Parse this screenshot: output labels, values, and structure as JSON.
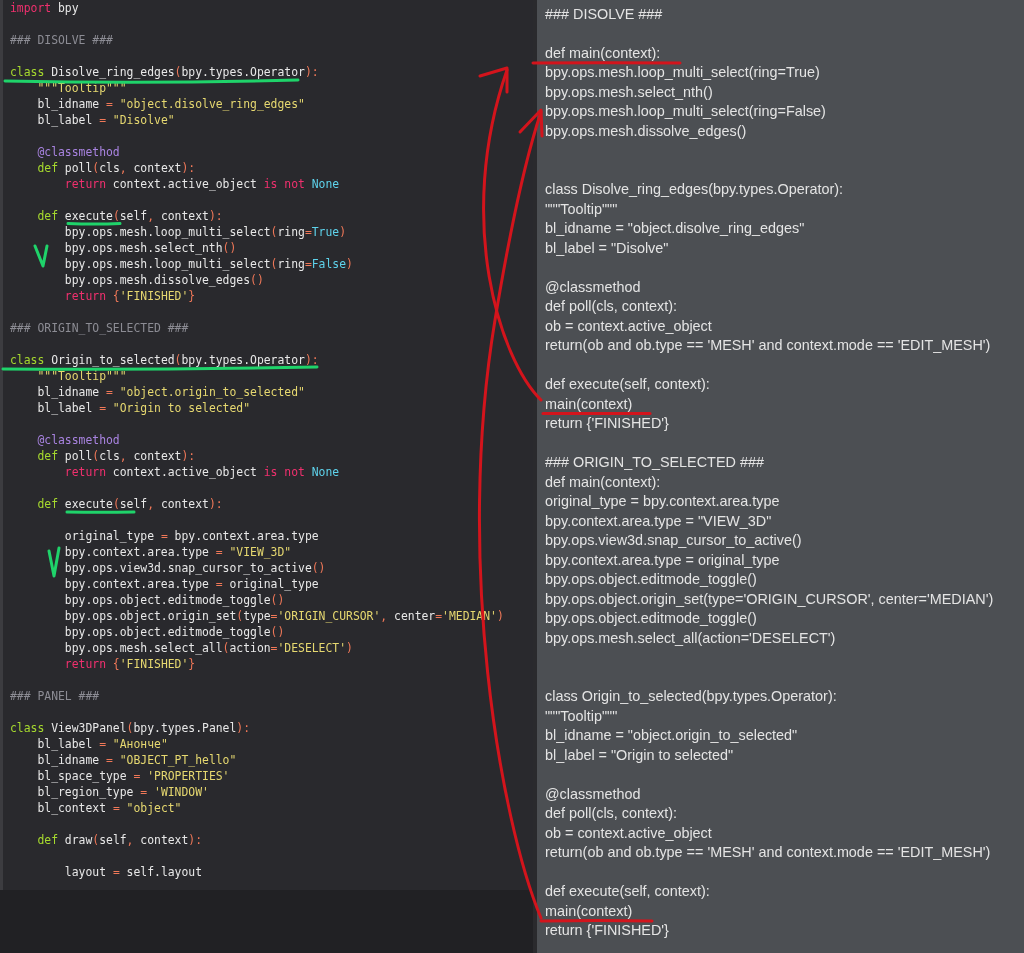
{
  "editor": {
    "lines": [
      {
        "kind": "code",
        "tokens": [
          {
            "text": "import",
            "kind": "kw"
          },
          {
            "text": " bpy",
            "kind": "id"
          }
        ]
      },
      {
        "kind": "blank"
      },
      {
        "kind": "code",
        "tokens": [
          {
            "text": "### DISOLVE ###",
            "kind": "cmt"
          }
        ]
      },
      {
        "kind": "blank"
      },
      {
        "kind": "code",
        "tokens": [
          {
            "text": "class",
            "kind": "def"
          },
          {
            "text": " Disolve_ring_edges",
            "kind": "id"
          },
          {
            "text": "(",
            "kind": "op"
          },
          {
            "text": "bpy.types.Operator",
            "kind": "id"
          },
          {
            "text": "):",
            "kind": "op"
          }
        ]
      },
      {
        "kind": "code",
        "tokens": [
          {
            "text": "    \"\"\"Tooltip\"\"\"",
            "kind": "str"
          }
        ]
      },
      {
        "kind": "code",
        "tokens": [
          {
            "text": "    bl_idname ",
            "kind": "id"
          },
          {
            "text": "=",
            "kind": "op"
          },
          {
            "text": " \"object.disolve_ring_edges\"",
            "kind": "str"
          }
        ]
      },
      {
        "kind": "code",
        "tokens": [
          {
            "text": "    bl_label ",
            "kind": "id"
          },
          {
            "text": "=",
            "kind": "op"
          },
          {
            "text": " \"Disolve\"",
            "kind": "str"
          }
        ]
      },
      {
        "kind": "blank"
      },
      {
        "kind": "code",
        "tokens": [
          {
            "text": "    @classmethod",
            "kind": "deco"
          }
        ]
      },
      {
        "kind": "code",
        "tokens": [
          {
            "text": "    def",
            "kind": "def"
          },
          {
            "text": " poll",
            "kind": "id"
          },
          {
            "text": "(",
            "kind": "op"
          },
          {
            "text": "cls",
            "kind": "id"
          },
          {
            "text": ", ",
            "kind": "op"
          },
          {
            "text": "context",
            "kind": "id"
          },
          {
            "text": "):",
            "kind": "op"
          }
        ]
      },
      {
        "kind": "code",
        "tokens": [
          {
            "text": "        return",
            "kind": "kw"
          },
          {
            "text": " context.active_object ",
            "kind": "id"
          },
          {
            "text": "is not",
            "kind": "kw"
          },
          {
            "text": " None",
            "kind": "const"
          }
        ]
      },
      {
        "kind": "blank"
      },
      {
        "kind": "code",
        "tokens": [
          {
            "text": "    def",
            "kind": "def"
          },
          {
            "text": " execute",
            "kind": "id"
          },
          {
            "text": "(",
            "kind": "op"
          },
          {
            "text": "self",
            "kind": "id"
          },
          {
            "text": ", ",
            "kind": "op"
          },
          {
            "text": "context",
            "kind": "id"
          },
          {
            "text": "):",
            "kind": "op"
          }
        ]
      },
      {
        "kind": "code",
        "tokens": [
          {
            "text": "        bpy.ops.mesh.loop_multi_select",
            "kind": "id"
          },
          {
            "text": "(",
            "kind": "op"
          },
          {
            "text": "ring",
            "kind": "id"
          },
          {
            "text": "=",
            "kind": "op"
          },
          {
            "text": "True",
            "kind": "const"
          },
          {
            "text": ")",
            "kind": "op"
          }
        ]
      },
      {
        "kind": "code",
        "tokens": [
          {
            "text": "        bpy.ops.mesh.select_nth",
            "kind": "id"
          },
          {
            "text": "()",
            "kind": "op"
          }
        ]
      },
      {
        "kind": "code",
        "tokens": [
          {
            "text": "        bpy.ops.mesh.loop_multi_select",
            "kind": "id"
          },
          {
            "text": "(",
            "kind": "op"
          },
          {
            "text": "ring",
            "kind": "id"
          },
          {
            "text": "=",
            "kind": "op"
          },
          {
            "text": "False",
            "kind": "const"
          },
          {
            "text": ")",
            "kind": "op"
          }
        ]
      },
      {
        "kind": "code",
        "tokens": [
          {
            "text": "        bpy.ops.mesh.dissolve_edges",
            "kind": "id"
          },
          {
            "text": "()",
            "kind": "op"
          }
        ]
      },
      {
        "kind": "code",
        "tokens": [
          {
            "text": "        return",
            "kind": "kw"
          },
          {
            "text": " {",
            "kind": "op"
          },
          {
            "text": "'FINISHED'",
            "kind": "str"
          },
          {
            "text": "}",
            "kind": "op"
          }
        ]
      },
      {
        "kind": "blank"
      },
      {
        "kind": "code",
        "tokens": [
          {
            "text": "### ORIGIN_TO_SELECTED ###",
            "kind": "cmt"
          }
        ]
      },
      {
        "kind": "blank"
      },
      {
        "kind": "code",
        "tokens": [
          {
            "text": "class",
            "kind": "def"
          },
          {
            "text": " Origin_to_selected",
            "kind": "id"
          },
          {
            "text": "(",
            "kind": "op"
          },
          {
            "text": "bpy.types.Operator",
            "kind": "id"
          },
          {
            "text": "):",
            "kind": "op"
          }
        ]
      },
      {
        "kind": "code",
        "tokens": [
          {
            "text": "    \"\"\"Tooltip\"\"\"",
            "kind": "str"
          }
        ]
      },
      {
        "kind": "code",
        "tokens": [
          {
            "text": "    bl_idname ",
            "kind": "id"
          },
          {
            "text": "=",
            "kind": "op"
          },
          {
            "text": " \"object.origin_to_selected\"",
            "kind": "str"
          }
        ]
      },
      {
        "kind": "code",
        "tokens": [
          {
            "text": "    bl_label ",
            "kind": "id"
          },
          {
            "text": "=",
            "kind": "op"
          },
          {
            "text": " \"Origin to selected\"",
            "kind": "str"
          }
        ]
      },
      {
        "kind": "blank"
      },
      {
        "kind": "code",
        "tokens": [
          {
            "text": "    @classmethod",
            "kind": "deco"
          }
        ]
      },
      {
        "kind": "code",
        "tokens": [
          {
            "text": "    def",
            "kind": "def"
          },
          {
            "text": " poll",
            "kind": "id"
          },
          {
            "text": "(",
            "kind": "op"
          },
          {
            "text": "cls",
            "kind": "id"
          },
          {
            "text": ", ",
            "kind": "op"
          },
          {
            "text": "context",
            "kind": "id"
          },
          {
            "text": "):",
            "kind": "op"
          }
        ]
      },
      {
        "kind": "code",
        "tokens": [
          {
            "text": "        return",
            "kind": "kw"
          },
          {
            "text": " context.active_object ",
            "kind": "id"
          },
          {
            "text": "is not",
            "kind": "kw"
          },
          {
            "text": " None",
            "kind": "const"
          }
        ]
      },
      {
        "kind": "blank"
      },
      {
        "kind": "code",
        "tokens": [
          {
            "text": "    def",
            "kind": "def"
          },
          {
            "text": " execute",
            "kind": "id"
          },
          {
            "text": "(",
            "kind": "op"
          },
          {
            "text": "self",
            "kind": "id"
          },
          {
            "text": ", ",
            "kind": "op"
          },
          {
            "text": "context",
            "kind": "id"
          },
          {
            "text": "):",
            "kind": "op"
          }
        ]
      },
      {
        "kind": "blank"
      },
      {
        "kind": "code",
        "tokens": [
          {
            "text": "        original_type ",
            "kind": "id"
          },
          {
            "text": "=",
            "kind": "op"
          },
          {
            "text": " bpy.context.area.type",
            "kind": "id"
          }
        ]
      },
      {
        "kind": "code",
        "tokens": [
          {
            "text": "        bpy.context.area.type ",
            "kind": "id"
          },
          {
            "text": "=",
            "kind": "op"
          },
          {
            "text": " \"VIEW_3D\"",
            "kind": "str"
          }
        ]
      },
      {
        "kind": "code",
        "tokens": [
          {
            "text": "        bpy.ops.view3d.snap_cursor_to_active",
            "kind": "id"
          },
          {
            "text": "()",
            "kind": "op"
          }
        ]
      },
      {
        "kind": "code",
        "tokens": [
          {
            "text": "        bpy.context.area.type ",
            "kind": "id"
          },
          {
            "text": "=",
            "kind": "op"
          },
          {
            "text": " original_type",
            "kind": "id"
          }
        ]
      },
      {
        "kind": "code",
        "tokens": [
          {
            "text": "        bpy.ops.object.editmode_toggle",
            "kind": "id"
          },
          {
            "text": "()",
            "kind": "op"
          }
        ]
      },
      {
        "kind": "code",
        "tokens": [
          {
            "text": "        bpy.ops.object.origin_set",
            "kind": "id"
          },
          {
            "text": "(",
            "kind": "op"
          },
          {
            "text": "type",
            "kind": "id"
          },
          {
            "text": "=",
            "kind": "op"
          },
          {
            "text": "'ORIGIN_CURSOR'",
            "kind": "str"
          },
          {
            "text": ", ",
            "kind": "op"
          },
          {
            "text": "center",
            "kind": "id"
          },
          {
            "text": "=",
            "kind": "op"
          },
          {
            "text": "'MEDIAN'",
            "kind": "str"
          },
          {
            "text": ")",
            "kind": "op"
          }
        ]
      },
      {
        "kind": "code",
        "tokens": [
          {
            "text": "        bpy.ops.object.editmode_toggle",
            "kind": "id"
          },
          {
            "text": "()",
            "kind": "op"
          }
        ]
      },
      {
        "kind": "code",
        "tokens": [
          {
            "text": "        bpy.ops.mesh.select_all",
            "kind": "id"
          },
          {
            "text": "(",
            "kind": "op"
          },
          {
            "text": "action",
            "kind": "id"
          },
          {
            "text": "=",
            "kind": "op"
          },
          {
            "text": "'DESELECT'",
            "kind": "str"
          },
          {
            "text": ")",
            "kind": "op"
          }
        ]
      },
      {
        "kind": "code",
        "tokens": [
          {
            "text": "        return",
            "kind": "kw"
          },
          {
            "text": " {",
            "kind": "op"
          },
          {
            "text": "'FINISHED'",
            "kind": "str"
          },
          {
            "text": "}",
            "kind": "op"
          }
        ]
      },
      {
        "kind": "blank"
      },
      {
        "kind": "code",
        "tokens": [
          {
            "text": "### PANEL ###",
            "kind": "cmt"
          }
        ]
      },
      {
        "kind": "blank"
      },
      {
        "kind": "code",
        "tokens": [
          {
            "text": "class",
            "kind": "def"
          },
          {
            "text": " View3DPanel",
            "kind": "id"
          },
          {
            "text": "(",
            "kind": "op"
          },
          {
            "text": "bpy.types.Panel",
            "kind": "id"
          },
          {
            "text": "):",
            "kind": "op"
          }
        ]
      },
      {
        "kind": "code",
        "tokens": [
          {
            "text": "    bl_label ",
            "kind": "id"
          },
          {
            "text": "=",
            "kind": "op"
          },
          {
            "text": " \"Анонче\"",
            "kind": "str"
          }
        ]
      },
      {
        "kind": "code",
        "tokens": [
          {
            "text": "    bl_idname ",
            "kind": "id"
          },
          {
            "text": "=",
            "kind": "op"
          },
          {
            "text": " \"OBJECT_PT_hello\"",
            "kind": "str"
          }
        ]
      },
      {
        "kind": "code",
        "tokens": [
          {
            "text": "    bl_space_type ",
            "kind": "id"
          },
          {
            "text": "=",
            "kind": "op"
          },
          {
            "text": " 'PROPERTIES'",
            "kind": "str"
          }
        ]
      },
      {
        "kind": "code",
        "tokens": [
          {
            "text": "    bl_region_type ",
            "kind": "id"
          },
          {
            "text": "=",
            "kind": "op"
          },
          {
            "text": " 'WINDOW'",
            "kind": "str"
          }
        ]
      },
      {
        "kind": "code",
        "tokens": [
          {
            "text": "    bl_context ",
            "kind": "id"
          },
          {
            "text": "=",
            "kind": "op"
          },
          {
            "text": " \"object\"",
            "kind": "str"
          }
        ]
      },
      {
        "kind": "blank"
      },
      {
        "kind": "code",
        "tokens": [
          {
            "text": "    def",
            "kind": "def"
          },
          {
            "text": " draw",
            "kind": "id"
          },
          {
            "text": "(",
            "kind": "op"
          },
          {
            "text": "self",
            "kind": "id"
          },
          {
            "text": ", ",
            "kind": "op"
          },
          {
            "text": "context",
            "kind": "id"
          },
          {
            "text": "):",
            "kind": "op"
          }
        ]
      },
      {
        "kind": "blank"
      },
      {
        "kind": "code",
        "tokens": [
          {
            "text": "        layout ",
            "kind": "id"
          },
          {
            "text": "=",
            "kind": "op"
          },
          {
            "text": " self.layout",
            "kind": "id"
          }
        ]
      }
    ]
  },
  "preview": {
    "lines": [
      {
        "kind": "text",
        "text": "### DISOLVE ###"
      },
      {
        "kind": "blank"
      },
      {
        "kind": "text",
        "text": "def main(context):"
      },
      {
        "kind": "text",
        "text": "bpy.ops.mesh.loop_multi_select(ring=True)"
      },
      {
        "kind": "text",
        "text": "bpy.ops.mesh.select_nth()"
      },
      {
        "kind": "text",
        "text": "bpy.ops.mesh.loop_multi_select(ring=False)"
      },
      {
        "kind": "text",
        "text": "bpy.ops.mesh.dissolve_edges()"
      },
      {
        "kind": "blank"
      },
      {
        "kind": "blank"
      },
      {
        "kind": "text",
        "text": "class Disolve_ring_edges(bpy.types.Operator):"
      },
      {
        "kind": "text",
        "text": "\"\"\"Tooltip\"\"\""
      },
      {
        "kind": "text",
        "text": "bl_idname = \"object.disolve_ring_edges\""
      },
      {
        "kind": "text",
        "text": "bl_label = \"Disolve\""
      },
      {
        "kind": "blank"
      },
      {
        "kind": "text",
        "text": "@classmethod"
      },
      {
        "kind": "text",
        "text": "def poll(cls, context):"
      },
      {
        "kind": "text",
        "text": "ob = context.active_object"
      },
      {
        "kind": "text",
        "text": "return(ob and ob.type == 'MESH' and context.mode == 'EDIT_MESH')"
      },
      {
        "kind": "blank"
      },
      {
        "kind": "text",
        "text": "def execute(self, context):"
      },
      {
        "kind": "text",
        "text": "main(context)"
      },
      {
        "kind": "text",
        "text": "return {'FINISHED'}"
      },
      {
        "kind": "blank"
      },
      {
        "kind": "text",
        "text": "### ORIGIN_TO_SELECTED ###"
      },
      {
        "kind": "text",
        "text": "def main(context):"
      },
      {
        "kind": "text",
        "text": "original_type = bpy.context.area.type"
      },
      {
        "kind": "text",
        "text": "bpy.context.area.type = \"VIEW_3D\""
      },
      {
        "kind": "text",
        "text": "bpy.ops.view3d.snap_cursor_to_active()"
      },
      {
        "kind": "text",
        "text": "bpy.context.area.type = original_type"
      },
      {
        "kind": "text",
        "text": "bpy.ops.object.editmode_toggle()"
      },
      {
        "kind": "text",
        "text": "bpy.ops.object.origin_set(type='ORIGIN_CURSOR', center='MEDIAN')"
      },
      {
        "kind": "text",
        "text": "bpy.ops.object.editmode_toggle()"
      },
      {
        "kind": "text",
        "text": "bpy.ops.mesh.select_all(action='DESELECT')"
      },
      {
        "kind": "blank"
      },
      {
        "kind": "blank"
      },
      {
        "kind": "text",
        "text": "class Origin_to_selected(bpy.types.Operator):"
      },
      {
        "kind": "text",
        "text": "\"\"\"Tooltip\"\"\""
      },
      {
        "kind": "text",
        "text": "bl_idname = \"object.origin_to_selected\""
      },
      {
        "kind": "text",
        "text": "bl_label = \"Origin to selected\""
      },
      {
        "kind": "blank"
      },
      {
        "kind": "text",
        "text": "@classmethod"
      },
      {
        "kind": "text",
        "text": "def poll(cls, context):"
      },
      {
        "kind": "text",
        "text": "ob = context.active_object"
      },
      {
        "kind": "text",
        "text": "return(ob and ob.type == 'MESH' and context.mode == 'EDIT_MESH')"
      },
      {
        "kind": "blank"
      },
      {
        "kind": "text",
        "text": "def execute(self, context):"
      },
      {
        "kind": "text",
        "text": "main(context)"
      },
      {
        "kind": "text",
        "text": "return {'FINISHED'}"
      }
    ]
  }
}
